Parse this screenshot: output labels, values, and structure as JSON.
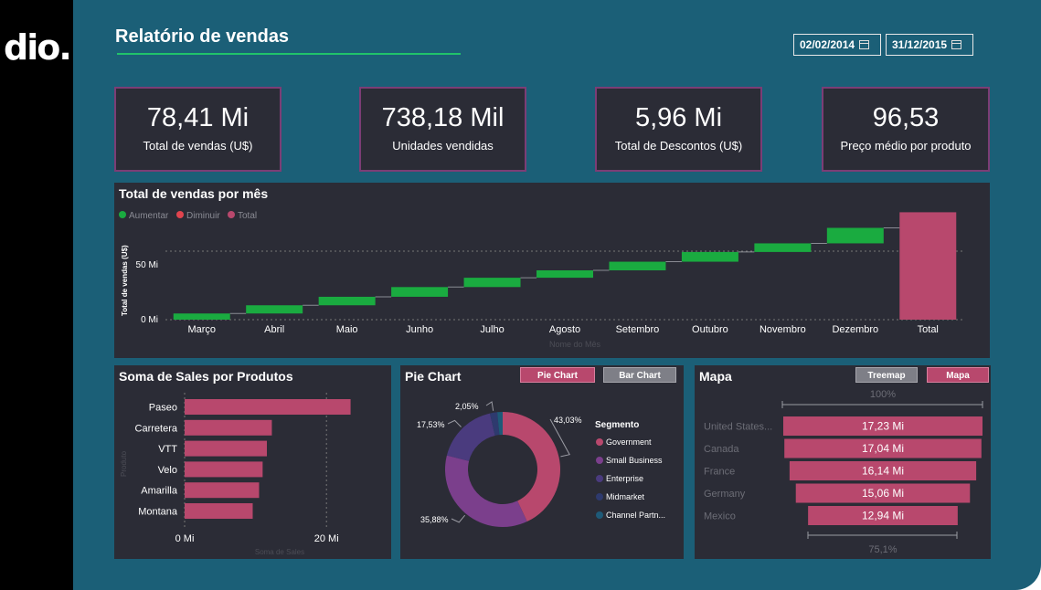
{
  "brand": {
    "logo_text": "dio."
  },
  "header": {
    "title": "Relatório de vendas",
    "date_start": "02/02/2014",
    "date_end": "31/12/2015"
  },
  "kpis": [
    {
      "value": "78,41 Mi",
      "label": "Total de vendas (U$)"
    },
    {
      "value": "738,18 Mil",
      "label": "Unidades vendidas"
    },
    {
      "value": "5,96 Mi",
      "label": "Total de Descontos (U$)"
    },
    {
      "value": "96,53",
      "label": "Preço médio por produto"
    }
  ],
  "colors": {
    "increase": "#1aab40",
    "decrease": "#e0444e",
    "total": "#b8486d",
    "bar": "#b8486d",
    "accent": "#21c26a"
  },
  "waterfall": {
    "title": "Total de vendas por mês",
    "legend": [
      "Aumentar",
      "Diminuir",
      "Total"
    ],
    "ylabel": "Total de vendas (U$)",
    "yticks": [
      "50 Mi",
      "0 Mi"
    ],
    "xlabel": "Nome do Mês"
  },
  "products": {
    "title": "Soma de Sales por Produtos",
    "xticks": [
      "0 Mi",
      "20 Mi"
    ],
    "xlabel": "Soma de Sales",
    "ylabel": "Produto"
  },
  "pie": {
    "title": "Pie Chart",
    "tab_active": "Pie Chart",
    "tab_inactive": "Bar Chart",
    "legend_title": "Segmento"
  },
  "map": {
    "title": "Mapa",
    "tab_inactive": "Treemap",
    "tab_active": "Mapa",
    "top_label": "100%",
    "bottom_label": "75,1%"
  },
  "chart_data": [
    {
      "type": "bar",
      "subtype": "waterfall",
      "title": "Total de vendas por mês",
      "ylabel": "Total de vendas (U$)",
      "xlabel": "Nome do Mês",
      "categories": [
        "Março",
        "Abril",
        "Maio",
        "Junho",
        "Julho",
        "Agosto",
        "Setembro",
        "Outubro",
        "Novembro",
        "Dezembro",
        "Total"
      ],
      "starts": [
        0,
        4.5,
        10.5,
        16.7,
        23.8,
        30.6,
        36.0,
        42.3,
        49.4,
        55.7,
        0
      ],
      "ends": [
        4.5,
        10.5,
        16.7,
        23.8,
        30.6,
        36.0,
        42.3,
        49.4,
        55.7,
        67.0,
        78.4
      ],
      "kinds": [
        "inc",
        "inc",
        "inc",
        "inc",
        "inc",
        "inc",
        "inc",
        "inc",
        "inc",
        "inc",
        "total"
      ],
      "ylim": [
        0,
        80
      ],
      "grid": true,
      "legend": "top-left"
    },
    {
      "type": "bar",
      "orientation": "horizontal",
      "title": "Soma de Sales por Produtos",
      "categories": [
        "Paseo",
        "Carretera",
        "VTT",
        "Velo",
        "Amarilla",
        "Montana"
      ],
      "values": [
        23.4,
        12.3,
        11.6,
        11.0,
        10.5,
        9.6
      ],
      "xlim": [
        0,
        25
      ],
      "xlabel": "Soma de Sales",
      "ylabel": "Produto"
    },
    {
      "type": "pie",
      "subtype": "donut",
      "title": "Pie Chart",
      "labels": [
        "Government",
        "Small Business",
        "Enterprise",
        "Midmarket",
        "Channel Partn..."
      ],
      "values": [
        43.03,
        35.88,
        17.53,
        2.05,
        1.51
      ],
      "value_labels": [
        "43,03%",
        "35,88%",
        "17,53%",
        "2,05%",
        ""
      ],
      "colors": [
        "#b8486d",
        "#7b3f8c",
        "#4a3b7e",
        "#2e3a6e",
        "#1e5a78"
      ],
      "legend": "right"
    },
    {
      "type": "bar",
      "subtype": "funnel",
      "title": "Mapa",
      "categories": [
        "United States...",
        "Canada",
        "France",
        "Germany",
        "Mexico"
      ],
      "values": [
        17.23,
        17.04,
        16.14,
        15.06,
        12.94
      ],
      "value_labels": [
        "17,23 Mi",
        "17,04 Mi",
        "16,14 Mi",
        "15,06 Mi",
        "12,94 Mi"
      ]
    }
  ]
}
